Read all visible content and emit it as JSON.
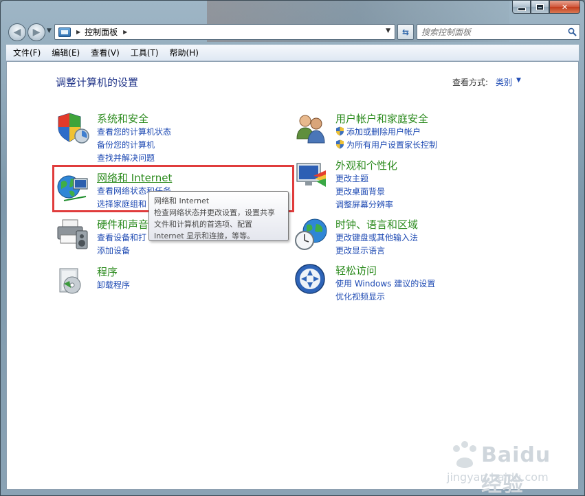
{
  "window": {
    "caption_buttons": {
      "minimize": "minimize-icon",
      "maximize": "maximize-icon",
      "close": "close-icon"
    }
  },
  "nav": {
    "breadcrumb_root": "控制面板",
    "search_placeholder": "搜索控制面板"
  },
  "menubar": {
    "items": [
      "文件(F)",
      "编辑(E)",
      "查看(V)",
      "工具(T)",
      "帮助(H)"
    ]
  },
  "main": {
    "page_title": "调整计算机的设置",
    "view_by_label": "查看方式:",
    "view_by_value": "类别"
  },
  "categories": [
    {
      "title": "系统和安全",
      "icon": "shield-security-icon",
      "links": [
        "查看您的计算机状态",
        "备份您的计算机",
        "查找并解决问题"
      ]
    },
    {
      "title": "网络和 Internet",
      "icon": "network-globe-icon",
      "links": [
        "查看网络状态和任务",
        "选择家庭组和"
      ]
    },
    {
      "title": "硬件和声音",
      "icon": "printer-speaker-icon",
      "links": [
        "查看设备和打",
        "添加设备"
      ]
    },
    {
      "title": "程序",
      "icon": "programs-disc-icon",
      "links": [
        "卸载程序"
      ]
    },
    {
      "title": "用户帐户和家庭安全",
      "icon": "users-icon",
      "links": [
        "添加或删除用户帐户",
        "为所有用户设置家长控制"
      ]
    },
    {
      "title": "外观和个性化",
      "icon": "appearance-monitor-icon",
      "links": [
        "更改主题",
        "更改桌面背景",
        "调整屏幕分辨率"
      ]
    },
    {
      "title": "时钟、语言和区域",
      "icon": "clock-globe-icon",
      "links": [
        "更改键盘或其他输入法",
        "更改显示语言"
      ]
    },
    {
      "title": "轻松访问",
      "icon": "ease-of-access-icon",
      "links": [
        "使用 Windows 建议的设置",
        "优化视频显示"
      ]
    }
  ],
  "tooltip": {
    "title": "网络和 Internet",
    "body": "检查网络状态并更改设置，设置共享\n文件和计算机的首选项、配置\nInternet 显示和连接，等等。"
  },
  "watermark": {
    "brand": "Baidu 经验",
    "url": "jingyan.baidu.com"
  }
}
